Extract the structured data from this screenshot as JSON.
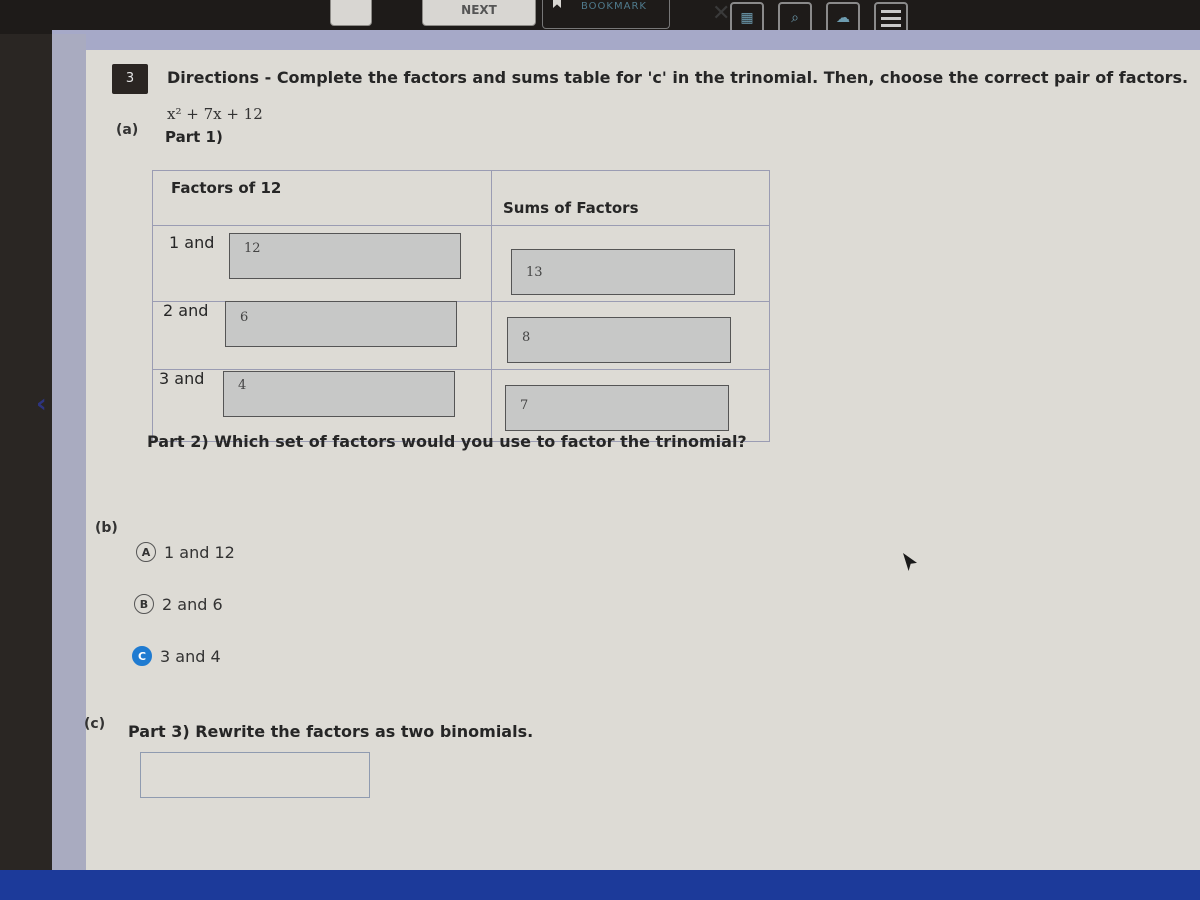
{
  "toolbar": {
    "next_label": "NEXT",
    "bookmark_label": "BOOKMARK",
    "close_label": "✕",
    "icons": [
      "calculator-icon",
      "search-icon",
      "cloud-icon",
      "menu-icon"
    ]
  },
  "question": {
    "number": "3",
    "directions": "Directions - Complete the factors and sums table for 'c' in the trinomial. Then, choose the correct pair of factors.",
    "expression": "x² + 7x + 12"
  },
  "part_a": {
    "label": "(a)",
    "title": "Part 1)",
    "table": {
      "headers": [
        "Factors of 12",
        "Sums of Factors"
      ],
      "rows": [
        {
          "factor_label": "1 and",
          "factor_value": "12",
          "sum_value": "13"
        },
        {
          "factor_label": "2 and",
          "factor_value": "6",
          "sum_value": "8"
        },
        {
          "factor_label": "3 and",
          "factor_value": "4",
          "sum_value": "7"
        }
      ]
    }
  },
  "part_b": {
    "label": "(b)",
    "title": "Part 2) Which set of factors would you use to factor the trinomial?",
    "choices": [
      {
        "letter": "A",
        "text": "1 and 12",
        "selected": false
      },
      {
        "letter": "B",
        "text": "2 and 6",
        "selected": false
      },
      {
        "letter": "C",
        "text": "3 and 4",
        "selected": true
      }
    ]
  },
  "part_c": {
    "label": "(c)",
    "title": "Part 3) Rewrite the factors as two binomials.",
    "answer_value": ""
  },
  "colors": {
    "selected_accent": "#1f7bd1",
    "header_band": "#a6a9c8",
    "bottom_band": "#1c3a9a"
  }
}
